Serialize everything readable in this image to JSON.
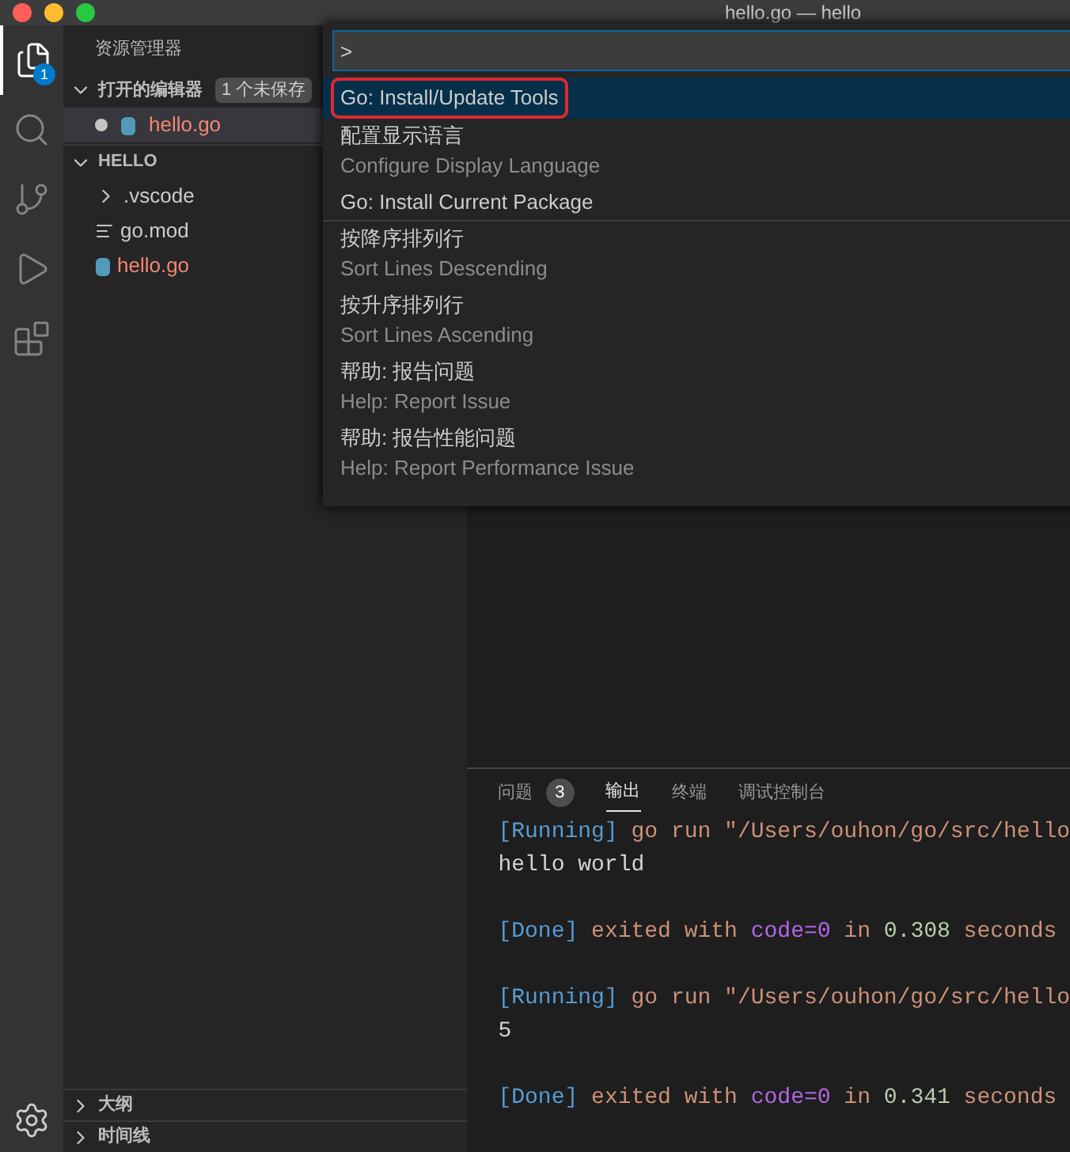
{
  "window": {
    "title": "hello.go — hello"
  },
  "activity_bar": {
    "items": [
      {
        "kind": "files",
        "selected": true,
        "badge": "1"
      },
      {
        "kind": "search",
        "selected": false
      },
      {
        "kind": "source-control",
        "selected": false
      },
      {
        "kind": "run",
        "selected": false
      },
      {
        "kind": "extensions",
        "selected": false
      }
    ]
  },
  "sidebar": {
    "title": "资源管理器",
    "open_editors": {
      "label": "打开的编辑器",
      "expanded": true,
      "badge": "1 个未保存",
      "items": [
        {
          "name": "hello.go",
          "dirty": true,
          "error": true
        }
      ]
    },
    "folder": {
      "label": "HELLO",
      "expanded": true,
      "items": [
        {
          "kind": "folder",
          "name": ".vscode",
          "expanded": false,
          "error": false
        },
        {
          "kind": "file",
          "name": "go.mod",
          "error": false
        },
        {
          "kind": "go",
          "name": "hello.go",
          "error": true
        }
      ]
    },
    "bottom_sections": [
      {
        "label": "大纲",
        "expanded": false
      },
      {
        "label": "时间线",
        "expanded": false
      }
    ]
  },
  "command_palette": {
    "value": ">",
    "items": [
      {
        "label": "Go: Install/Update Tools",
        "selected": true,
        "highlighted": true,
        "separator": false
      },
      {
        "label": "配置显示语言",
        "detail": "Configure Display Language",
        "selected": false,
        "highlighted": false,
        "separator": false
      },
      {
        "label": "Go: Install Current Package",
        "selected": false,
        "highlighted": false,
        "separator": true
      },
      {
        "label": "按降序排列行",
        "detail": "Sort Lines Descending",
        "selected": false,
        "highlighted": false,
        "separator": false
      },
      {
        "label": "按升序排列行",
        "detail": "Sort Lines Ascending",
        "selected": false,
        "highlighted": false,
        "separator": false
      },
      {
        "label": "帮助: 报告问题",
        "detail": "Help: Report Issue",
        "selected": false,
        "highlighted": false,
        "separator": false
      },
      {
        "label": "帮助: 报告性能问题",
        "detail": "Help: Report Performance Issue",
        "selected": false,
        "highlighted": false,
        "separator": false
      }
    ]
  },
  "panel": {
    "tabs": [
      {
        "label": "问题",
        "badge": "3",
        "selected": false
      },
      {
        "label": "输出",
        "selected": true
      },
      {
        "label": "终端",
        "selected": false
      },
      {
        "label": "调试控制台",
        "selected": false
      }
    ],
    "output": [
      {
        "kind": "text",
        "segments": [
          {
            "text": "[Running]",
            "color": "#569cd6"
          },
          {
            "text": " go run \"/Users/ouhon/go/src/hello",
            "color": "#ce9178"
          }
        ]
      },
      {
        "kind": "text",
        "segments": [
          {
            "text": "hello world",
            "color": "#d4d4d4"
          }
        ]
      },
      {
        "kind": "blank"
      },
      {
        "kind": "text",
        "segments": [
          {
            "text": "[Done]",
            "color": "#569cd6"
          },
          {
            "text": " exited with ",
            "color": "#ce9178"
          },
          {
            "text": "code=0",
            "color": "#b267e6"
          },
          {
            "text": " in ",
            "color": "#ce9178"
          },
          {
            "text": "0.308",
            "color": "#b5cea8"
          },
          {
            "text": " seconds",
            "color": "#ce9178"
          }
        ]
      },
      {
        "kind": "blank"
      },
      {
        "kind": "text",
        "segments": [
          {
            "text": "[Running]",
            "color": "#569cd6"
          },
          {
            "text": " go run \"/Users/ouhon/go/src/hello",
            "color": "#ce9178"
          }
        ]
      },
      {
        "kind": "text",
        "segments": [
          {
            "text": "5",
            "color": "#d4d4d4"
          }
        ]
      },
      {
        "kind": "blank"
      },
      {
        "kind": "text",
        "segments": [
          {
            "text": "[Done]",
            "color": "#569cd6"
          },
          {
            "text": " exited with ",
            "color": "#ce9178"
          },
          {
            "text": "code=0",
            "color": "#b267e6"
          },
          {
            "text": " in ",
            "color": "#ce9178"
          },
          {
            "text": "0.341",
            "color": "#b5cea8"
          },
          {
            "text": " seconds",
            "color": "#ce9178"
          }
        ]
      }
    ]
  }
}
